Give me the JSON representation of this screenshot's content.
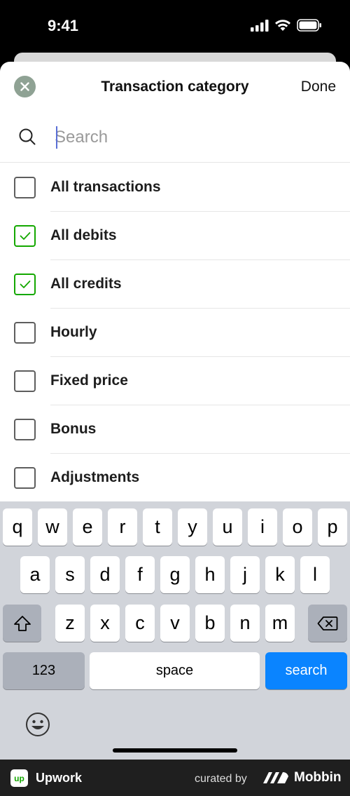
{
  "status_bar": {
    "time": "9:41"
  },
  "sheet": {
    "title": "Transaction category",
    "done_label": "Done",
    "search": {
      "placeholder": "Search",
      "value": ""
    },
    "items": [
      {
        "label": "All transactions",
        "checked": false
      },
      {
        "label": "All debits",
        "checked": true
      },
      {
        "label": "All credits",
        "checked": true
      },
      {
        "label": "Hourly",
        "checked": false
      },
      {
        "label": "Fixed price",
        "checked": false
      },
      {
        "label": "Bonus",
        "checked": false
      },
      {
        "label": "Adjustments",
        "checked": false
      }
    ]
  },
  "keyboard": {
    "row1": [
      "q",
      "w",
      "e",
      "r",
      "t",
      "y",
      "u",
      "i",
      "o",
      "p"
    ],
    "row2": [
      "a",
      "s",
      "d",
      "f",
      "g",
      "h",
      "j",
      "k",
      "l"
    ],
    "row3": [
      "z",
      "x",
      "c",
      "v",
      "b",
      "n",
      "m"
    ],
    "numbers_label": "123",
    "space_label": "space",
    "search_label": "search"
  },
  "footer": {
    "app_name": "Upwork",
    "app_logo_text": "up",
    "curated_by": "curated by",
    "curator": "Mobbin"
  },
  "colors": {
    "accent_green": "#14a800",
    "close_button": "#8fa294",
    "keyboard_bg": "#d1d4da",
    "search_key": "#0a84ff"
  }
}
